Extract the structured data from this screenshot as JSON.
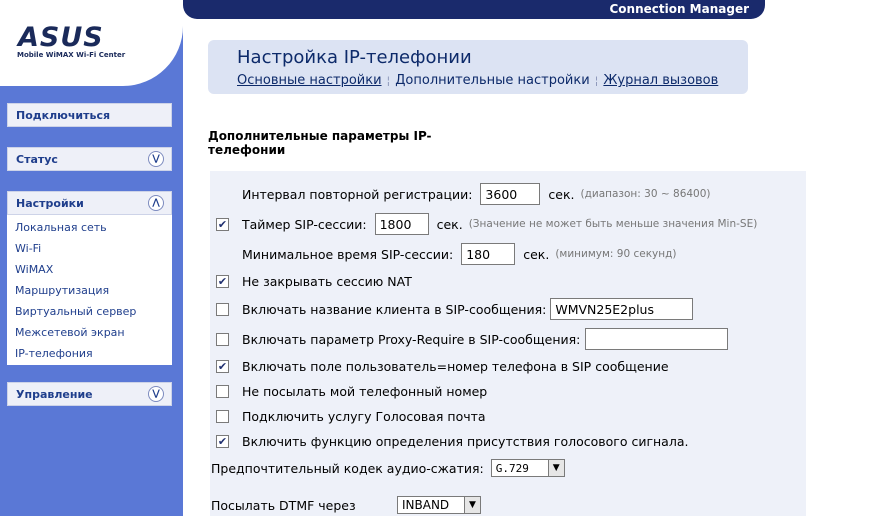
{
  "brand": {
    "logo": "ASUS",
    "subtitle": "Mobile WiMAX Wi-Fi Center"
  },
  "header": {
    "title": "Connection Manager"
  },
  "sidebar": {
    "connect": "Подключиться",
    "status": "Статус",
    "settings": "Настройки",
    "settings_items": [
      "Локальная сеть",
      "Wi-Fi",
      "WiMAX",
      "Маршрутизация",
      "Виртуальный сервер",
      "Межсетевой экран",
      "IP-телефония"
    ],
    "management": "Управление"
  },
  "page": {
    "title": "Настройка IP-телефонии",
    "tabs": [
      "Основные настройки",
      "Дополнительные настройки",
      "Журнал вызовов"
    ],
    "section_title": "Дополнительные параметры IP-телефонии"
  },
  "form": {
    "reg_interval": {
      "label": "Интервал повторной регистрации:",
      "value": "3600",
      "unit": "сек.",
      "hint": "(диапазон: 30 ~ 86400)"
    },
    "sip_timer": {
      "label": "Таймер SIP-сессии:",
      "value": "1800",
      "unit": "сек.",
      "hint": "(Значение не может быть меньше значения Min-SE)",
      "checked": true
    },
    "min_sip": {
      "label": "Минимальное время SIP-сессии:",
      "value": "180",
      "unit": "сек.",
      "hint": "(минимум: 90 секунд)"
    },
    "nat": {
      "label": "Не закрывать сессию NAT",
      "checked": true
    },
    "client_name": {
      "label": "Включать название клиента в SIP-сообщения:",
      "value": "WMVN25E2plus",
      "checked": false
    },
    "proxy_require": {
      "label": "Включать параметр Proxy-Require в SIP-сообщения:",
      "value": "",
      "checked": false
    },
    "user_phone": {
      "label": "Включать поле пользователь=номер телефона в SIP сообщение",
      "checked": true
    },
    "no_number": {
      "label": "Не посылать мой телефонный номер",
      "checked": false
    },
    "voicemail": {
      "label": "Подключить услугу Голосовая почта",
      "checked": false
    },
    "voice_detect": {
      "label": "Включить функцию определения присутствия голосового сигнала.",
      "checked": true
    },
    "codec": {
      "label": "Предпочтительный кодек аудио-сжатия:",
      "value": "G.729"
    },
    "dtmf": {
      "label": "Посылать DTMF через",
      "value": "INBAND"
    }
  }
}
